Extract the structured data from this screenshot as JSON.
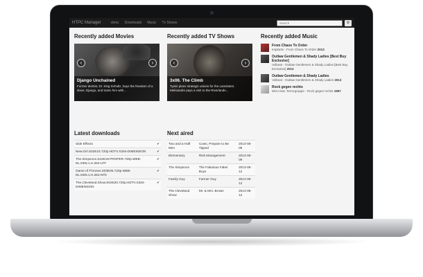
{
  "navbar": {
    "brand": "HTPC Manager",
    "links": [
      "xbmc",
      "Downloads",
      "Music",
      "Tv Shows"
    ],
    "search_placeholder": "Search",
    "settings_icon": "gear-icon"
  },
  "movies": {
    "heading": "Recently added Movies",
    "title": "Django Unchained",
    "description": "Former dentist, Dr. King Schultz, buys the freedom of a slave, Django, and trains him with..."
  },
  "tvshows": {
    "heading": "Recently added TV Shows",
    "title": "3x06. The Climb",
    "description": "Tywin plans strategic unions for the Lannisters. Melisandre pays a visit to the Riverlands..."
  },
  "music": {
    "heading": "Recently added Music",
    "items": [
      {
        "title": "From Chaos To Order",
        "artist_album": "Implants - From Chaos To Order",
        "year": "2013"
      },
      {
        "title": "Outlaw Gentlemen & Shady Ladies [Best Buy Exclusive]",
        "artist_album": "Volbeat - Outlaw Gentlemen & Shady Ladies [Best Buy Exclusive]",
        "year": "2013"
      },
      {
        "title": "Outlaw Gentlemen & Shady Ladies",
        "artist_album": "Volbeat - Outlaw Gentlemen & Shady Ladies",
        "year": "2013"
      },
      {
        "title": "Rock gegen rechts",
        "artist_album": "Wizo feat. Terrorgruppe - Rock gegen rechts",
        "year": "1997"
      }
    ]
  },
  "downloads": {
    "heading": "Latest downloads",
    "rows": [
      "Side Effects",
      "New.Girl.S02E24.720p.HDTV.X264-DIMENSION",
      "The.Simpsons.S24E19.PROPER.720p.WEB-DL.DD5.1.H.264-LFF",
      "Game.of.Thrones.S03E06.720p.WEB-DL.DD5.1.H.264-NTb",
      "The.Cleveland.Show.S04E20.720p.HDTV.X264-DIMENSION"
    ]
  },
  "next_aired": {
    "heading": "Next aired",
    "rows": [
      {
        "show": "Two and a Half Men",
        "episode": "Cows, Prepare to Be Tipped",
        "date": "2013-05-09"
      },
      {
        "show": "Elementary",
        "episode": "Risk Management",
        "date": "2013-05-09"
      },
      {
        "show": "The Simpsons",
        "episode": "The Fabulous Faker Boys",
        "date": "2013-05-12"
      },
      {
        "show": "Family Guy",
        "episode": "Farmer Guy",
        "date": "2013-05-12"
      },
      {
        "show": "The Cleveland Show",
        "episode": "Mr. & Mrs. Brown",
        "date": "2013-05-12"
      }
    ]
  }
}
